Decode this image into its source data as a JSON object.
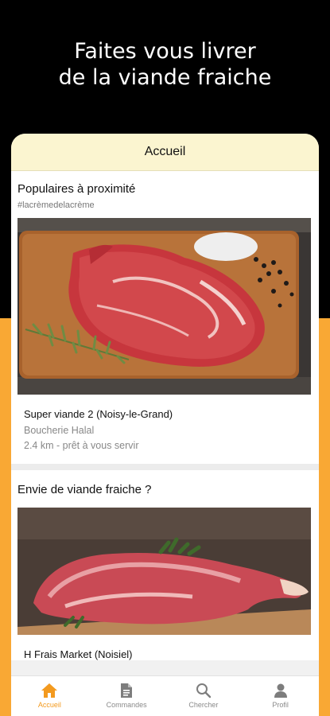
{
  "promo": {
    "line1": "Faites vous livrer",
    "line2": "de la viande fraiche"
  },
  "header": {
    "title": "Accueil"
  },
  "popular": {
    "title": "Populaires à proximité",
    "tag": "#lacrèmedelacrème",
    "card": {
      "name": "Super viande 2 (Noisy-le-Grand)",
      "type": "Boucherie Halal",
      "meta": "2.4 km - prêt à vous servir"
    }
  },
  "fresh": {
    "title": "Envie de viande fraiche ?",
    "card": {
      "name": "H Frais Market (Noisiel)"
    }
  },
  "nav": {
    "items": [
      {
        "label": "Accueil",
        "icon": "home-icon"
      },
      {
        "label": "Commandes",
        "icon": "document-icon"
      },
      {
        "label": "Chercher",
        "icon": "search-icon"
      },
      {
        "label": "Profil",
        "icon": "user-icon"
      }
    ]
  },
  "colors": {
    "accent": "#f39a1f",
    "background_bottom": "#f9a834",
    "header_bg": "#fbf5d0"
  }
}
